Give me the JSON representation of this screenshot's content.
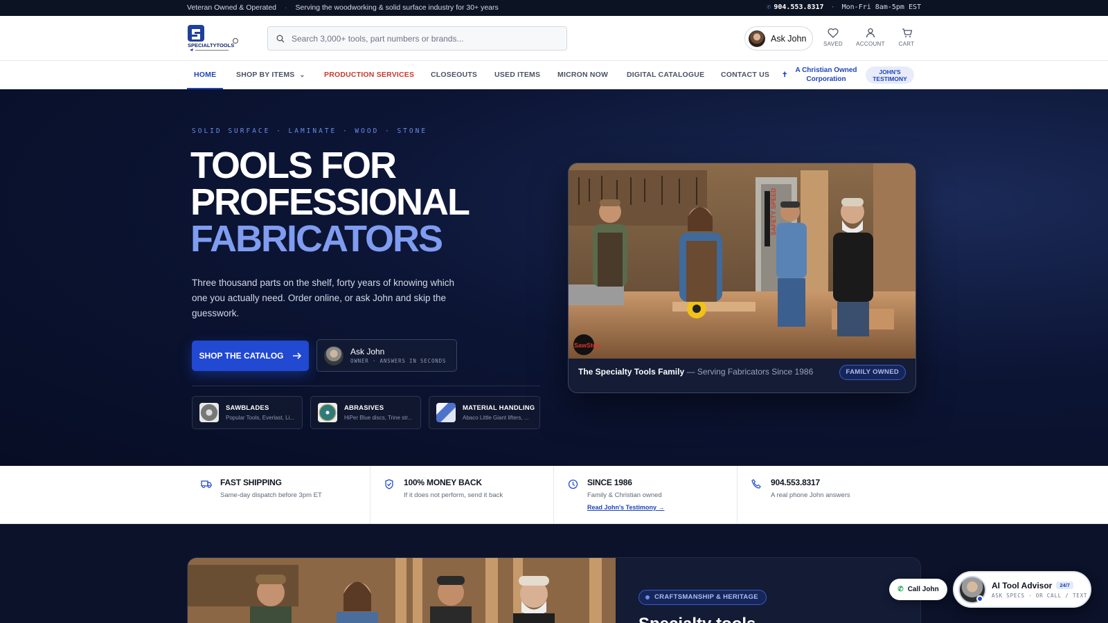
{
  "topbar": {
    "left1": "Veteran Owned & Operated",
    "left2": "Serving the woodworking & solid surface industry for 30+ years",
    "phone": "904.553.8317",
    "hours": "Mon-Fri 8am-5pm EST"
  },
  "header": {
    "search_placeholder": "Search 3,000+ tools, part numbers or brands...",
    "ask_john": "Ask John",
    "saved": "SAVED",
    "account": "ACCOUNT",
    "cart": "CART"
  },
  "nav": {
    "items": [
      "HOME",
      "SHOP BY ITEMS",
      "PRODUCTION SERVICES",
      "CLOSEOUTS",
      "USED ITEMS",
      "MICRON NOW",
      "DIGITAL CATALOGUE",
      "CONTACT US"
    ],
    "christian_line1": "A Christian Owned",
    "christian_line2": "Corporation",
    "testimony_line1": "JOHN'S",
    "testimony_line2": "TESTIMONY"
  },
  "hero": {
    "eyebrow": "SOLID SURFACE · LAMINATE · WOOD · STONE",
    "title_line1": "TOOLS FOR",
    "title_line2": "PROFESSIONAL",
    "title_line3": "FABRICATORS",
    "lede": "Three thousand parts on the shelf, forty years of knowing which one you actually need. Order online, or ask John and skip the guesswork.",
    "shop_label": "SHOP THE CATALOG",
    "ask_title": "Ask John",
    "ask_sub": "OWNER · ANSWERS IN SECONDS",
    "categories": [
      {
        "name": "SAWBLADES",
        "sub": "Popular Tools, Everlast, Li..."
      },
      {
        "name": "ABRASIVES",
        "sub": "HiPer Blue discs, Trine str..."
      },
      {
        "name": "MATERIAL HANDLING",
        "sub": "Abaco Little Giant lifters, ..."
      }
    ],
    "caption_bold": "The Specialty Tools Family",
    "caption_rest": " — Serving Fabricators Since 1986",
    "family_pill": "FAMILY OWNED",
    "photo_text_saw": "SAFETY SPEED",
    "photo_text_logo": "SawStop"
  },
  "features": [
    {
      "title": "FAST SHIPPING",
      "desc": "Same-day dispatch before 3pm ET",
      "icon": "truck-icon"
    },
    {
      "title": "100% MONEY BACK",
      "desc": "If it does not perform, send it back",
      "icon": "shield-check-icon"
    },
    {
      "title": "SINCE 1986",
      "desc": "Family & Christian owned",
      "link": "Read John's Testimony →",
      "icon": "clock-icon"
    },
    {
      "title": "904.553.8317",
      "desc": "A real phone John answers",
      "icon": "phone-icon"
    }
  ],
  "lower": {
    "pill": "CRAFTSMANSHIP & HERITAGE",
    "title": "Specialty tools"
  },
  "floating": {
    "call_john": "Call John",
    "advisor_title": "AI Tool Advisor",
    "advisor_badge": "24/7",
    "advisor_sub": "ASK SPECS · OR CALL / TEXT"
  },
  "colors": {
    "primary": "#2149d1",
    "accent_light": "#7f9cf0",
    "production_red": "#c8382c",
    "hero_bg": "#0a1128"
  }
}
